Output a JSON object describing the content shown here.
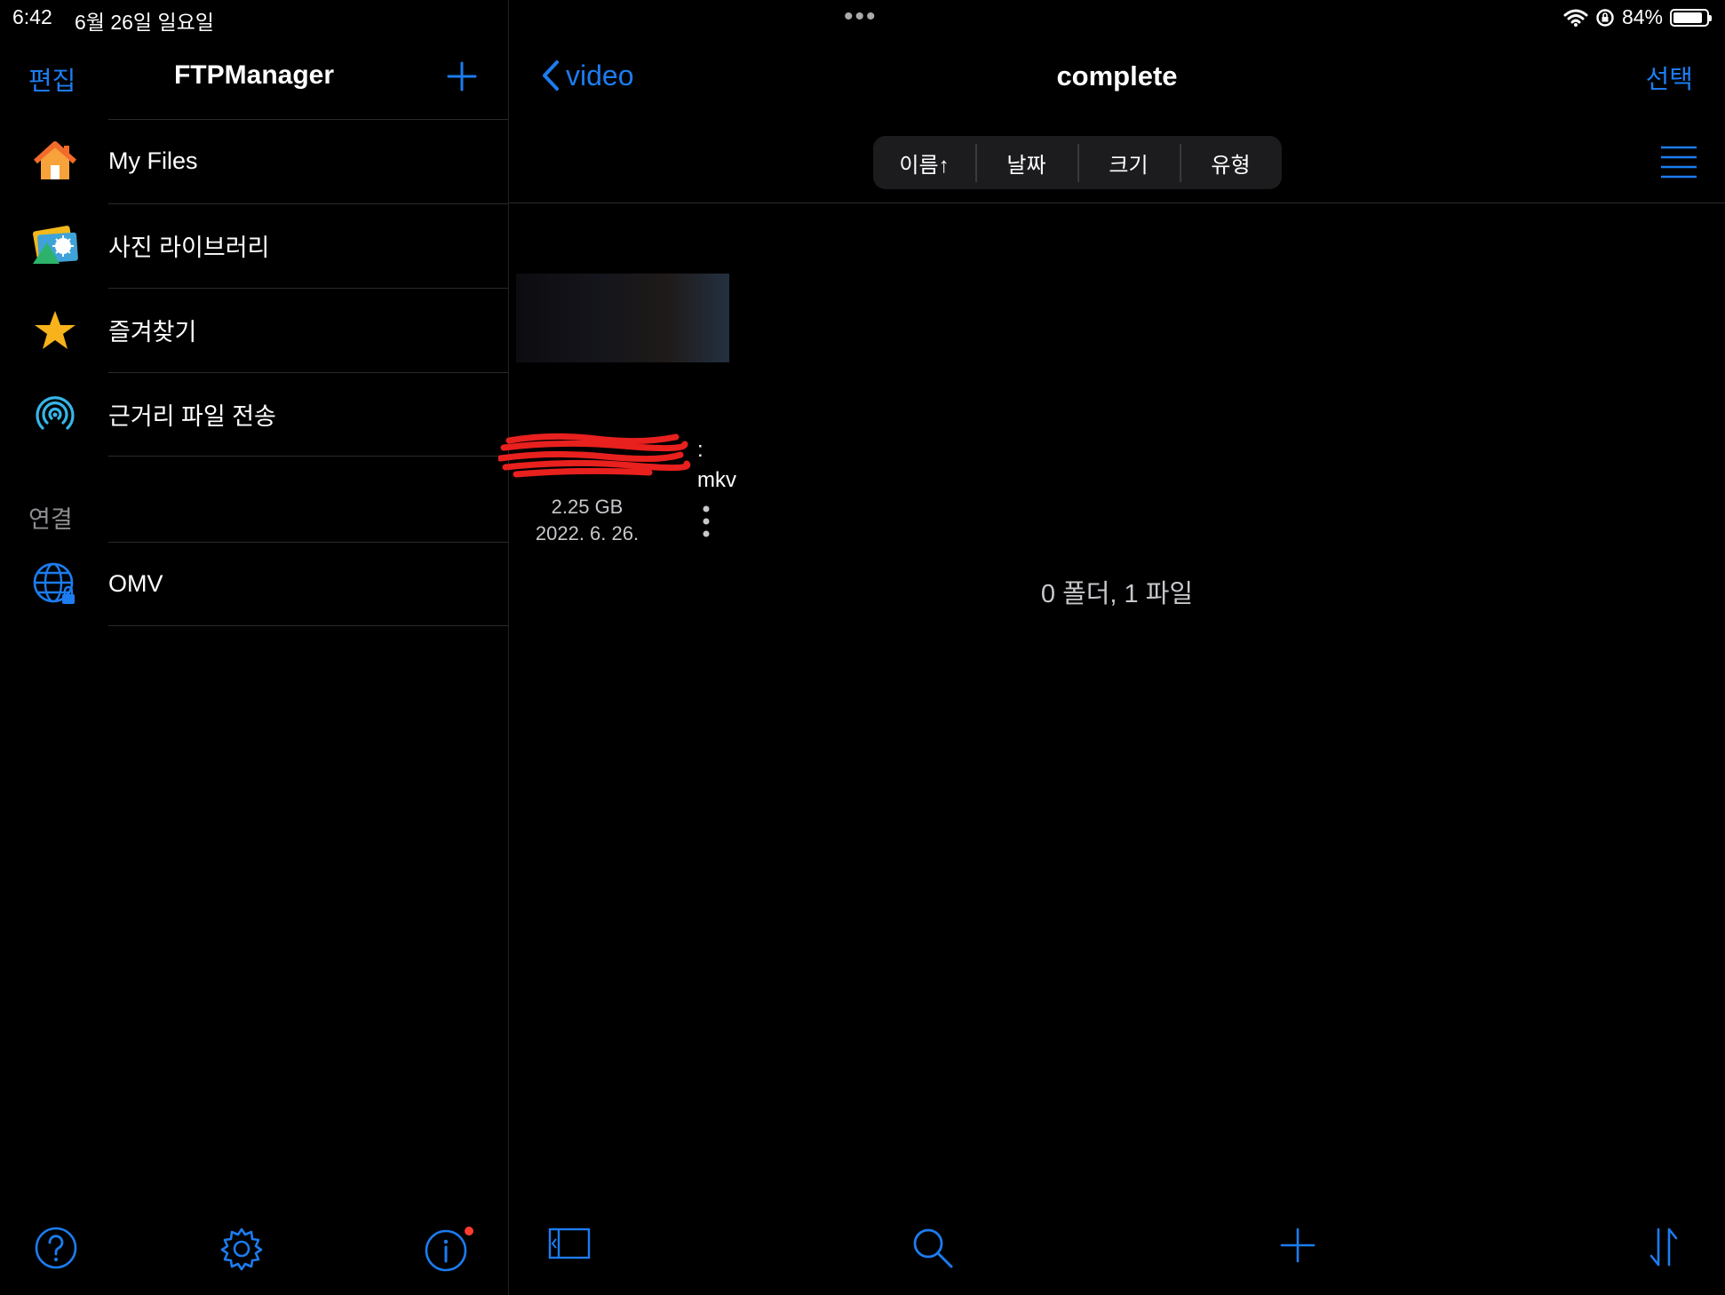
{
  "status": {
    "time": "6:42",
    "date": "6월 26일 일요일",
    "battery": "84%",
    "battery_level": 0.84
  },
  "sidebar": {
    "edit_label": "편집",
    "title": "FTPManager",
    "items": [
      {
        "label": "My Files",
        "icon": "home-icon"
      },
      {
        "label": "사진 라이브러리",
        "icon": "photo-library-icon"
      },
      {
        "label": "즐겨찾기",
        "icon": "star-icon"
      },
      {
        "label": "근거리 파일 전송",
        "icon": "airdrop-icon"
      }
    ],
    "section_label": "연결",
    "connections": [
      {
        "label": "OMV",
        "icon": "globe-lock-icon"
      }
    ]
  },
  "main": {
    "back_label": "video",
    "title": "complete",
    "select_label": "선택",
    "sort_options": [
      "이름↑",
      "날짜",
      "크기",
      "유형"
    ],
    "file": {
      "name_line1": ":",
      "name_line2": "mkv",
      "size": "2.25 GB",
      "date": "2022. 6. 26."
    },
    "summary": "0 폴더, 1 파일"
  },
  "colors": {
    "accent": "#1c7cf0",
    "background": "#000000",
    "notification": "#ff3b30"
  }
}
